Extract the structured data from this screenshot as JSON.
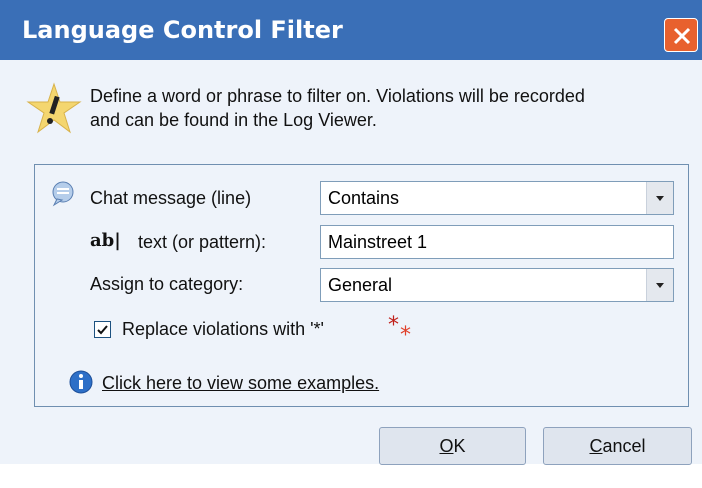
{
  "window": {
    "title": "Language Control Filter"
  },
  "info": {
    "line1": "Define a word or phrase to filter on. Violations will be recorded",
    "line2": "and can be found in the Log Viewer."
  },
  "form": {
    "chat_label": "Chat message (line)",
    "chat_value": "Contains",
    "text_prefix": "ab|",
    "text_label": "text (or pattern):",
    "text_value": "Mainstreet 1",
    "category_label": "Assign to category:",
    "category_value": "General",
    "replace_label": "Replace violations with '*'",
    "replace_checked": true,
    "examples_link": "Click here to view some examples."
  },
  "buttons": {
    "ok_first": "O",
    "ok_rest": "K",
    "cancel_first": "C",
    "cancel_rest": "ancel"
  }
}
